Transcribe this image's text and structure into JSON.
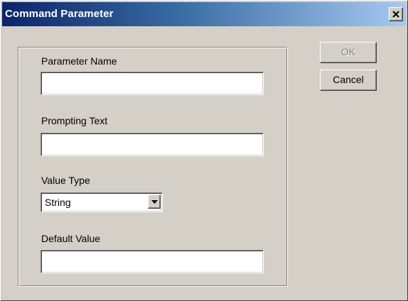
{
  "window": {
    "title": "Command Parameter"
  },
  "form": {
    "parameter_name_label": "Parameter Name",
    "parameter_name_value": "",
    "prompting_text_label": "Prompting Text",
    "prompting_text_value": "",
    "value_type_label": "Value Type",
    "value_type_selected": "String",
    "default_value_label": "Default Value",
    "default_value_value": ""
  },
  "buttons": {
    "ok_label": "OK",
    "ok_enabled": false,
    "cancel_label": "Cancel"
  },
  "icons": {
    "close": "close-icon",
    "dropdown": "chevron-down-icon"
  },
  "colors": {
    "titlebar_start": "#0a246a",
    "titlebar_end": "#a6caf0",
    "face": "#d4d0c8"
  }
}
